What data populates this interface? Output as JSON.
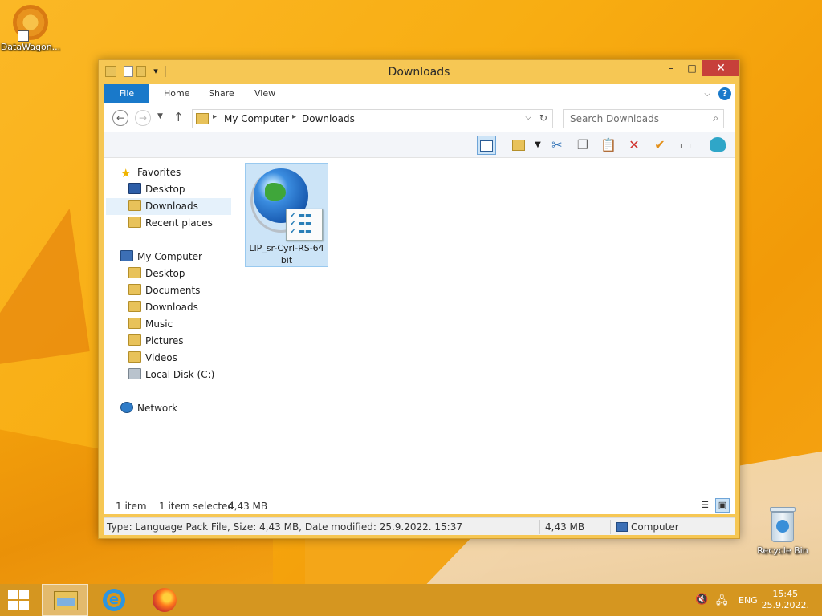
{
  "desktop": {
    "icons": [
      {
        "label": "DataWagon..."
      },
      {
        "label": "Recycle Bin"
      }
    ]
  },
  "window": {
    "title": "Downloads",
    "controls": {
      "minimize": "–",
      "maximize": "□",
      "close": "✕"
    },
    "ribbon_tabs": [
      "File",
      "Home",
      "Share",
      "View"
    ],
    "address": {
      "crumbs": [
        "My Computer",
        "Downloads"
      ]
    },
    "search": {
      "placeholder": "Search Downloads"
    },
    "nav": {
      "favorites_label": "Favorites",
      "favorites": [
        "Desktop",
        "Downloads",
        "Recent places"
      ],
      "computer_label": "My Computer",
      "computer": [
        "Desktop",
        "Documents",
        "Downloads",
        "Music",
        "Pictures",
        "Videos",
        "Local Disk (C:)"
      ],
      "network_label": "Network",
      "selected": "Downloads"
    },
    "files": [
      {
        "name": "LIP_sr-Cyrl-RS-64bit",
        "icon": "language-pack-globe-icon",
        "selected": true
      }
    ],
    "status": {
      "item_count": "1 item",
      "selection": "1 item selected",
      "selection_size": "4,43 MB"
    },
    "details": {
      "description": "Type: Language Pack File, Size: 4,43 MB, Date modified: 25.9.2022. 15:37",
      "size": "4,43 MB",
      "location": "Computer"
    }
  },
  "taskbar": {
    "apps": [
      "File Explorer",
      "Internet Explorer",
      "Firefox"
    ],
    "active_app": "File Explorer",
    "language": "ENG",
    "time": "15:45",
    "date": "25.9.2022."
  },
  "colors": {
    "accent": "#1979ca",
    "close_button": "#c7403a",
    "selection": "#cce4f7",
    "window_frame": "#f6c754",
    "taskbar": "#d59620"
  }
}
